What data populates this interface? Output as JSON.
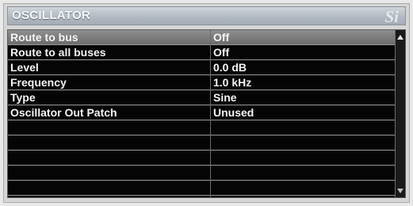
{
  "header": {
    "title": "OSCILLATOR",
    "logo_text": "Si"
  },
  "rows": [
    {
      "label": "Route to bus",
      "value": "Off",
      "selected": true
    },
    {
      "label": "Route to all buses",
      "value": "Off"
    },
    {
      "label": "Level",
      "value": "0.0 dB"
    },
    {
      "label": "Frequency",
      "value": "1.0 kHz"
    },
    {
      "label": "Type",
      "value": "Sine"
    },
    {
      "label": "Oscillator Out Patch",
      "value": "Unused"
    },
    {
      "label": "",
      "value": ""
    },
    {
      "label": "",
      "value": ""
    },
    {
      "label": "",
      "value": ""
    },
    {
      "label": "",
      "value": ""
    },
    {
      "label": "",
      "value": ""
    }
  ],
  "colors": {
    "selected_row": "#7c7c7c",
    "panel_bg": "#050505",
    "text": "#f5f5f5"
  },
  "icons": {
    "scroll_up": "arrow-up-icon",
    "scroll_down": "arrow-down-icon"
  }
}
